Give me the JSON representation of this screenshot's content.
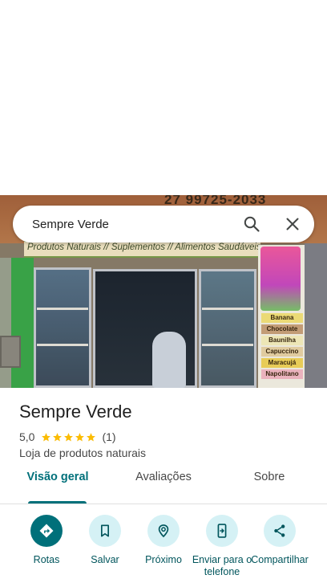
{
  "search": {
    "value": "Sempre Verde"
  },
  "photo": {
    "phone_text": "27 99725-2033",
    "banner_text": "Produtos Naturais // Suplementos // Alimentos Saudáveis",
    "flavors": [
      "Banana",
      "Chocolate",
      "Baunilha",
      "Capuccino",
      "Maracujá",
      "Napolitano"
    ]
  },
  "place": {
    "name": "Sempre Verde",
    "rating": "5,0",
    "stars": 5,
    "review_count": "(1)",
    "category": "Loja de produtos naturais"
  },
  "tabs": [
    {
      "label": "Visão geral",
      "active": true
    },
    {
      "label": "Avaliações",
      "active": false
    },
    {
      "label": "Sobre",
      "active": false
    }
  ],
  "actions": [
    {
      "label": "Rotas",
      "icon": "directions-icon"
    },
    {
      "label": "Salvar",
      "icon": "bookmark-icon"
    },
    {
      "label": "Próximo",
      "icon": "nearby-icon"
    },
    {
      "label": "Enviar para o telefone",
      "icon": "send-to-phone-icon"
    },
    {
      "label": "Compartilhar",
      "icon": "share-icon"
    }
  ],
  "colors": {
    "accent": "#00707a",
    "accent_light": "#d5f1f5",
    "star": "#fbbc04"
  }
}
